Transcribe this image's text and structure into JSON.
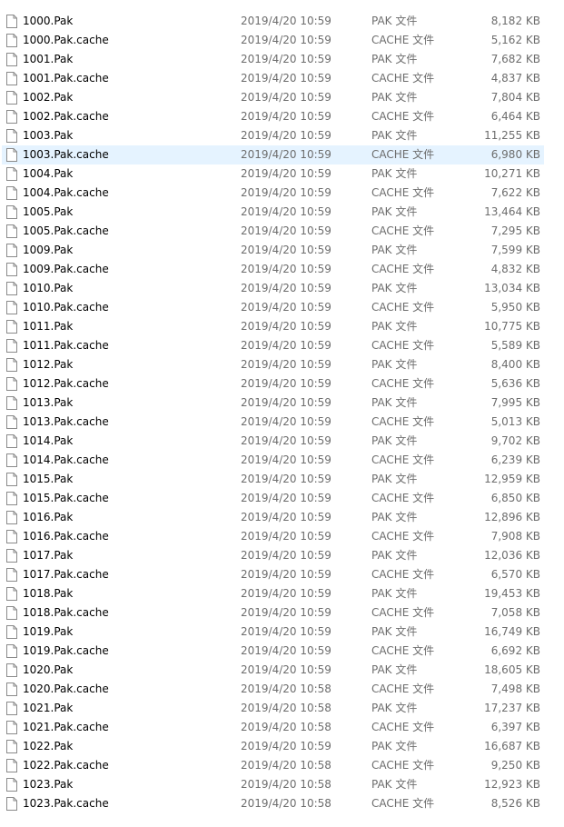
{
  "colors": {
    "name_text": "#000000",
    "detail_text": "#6d6d6d",
    "selected_row": "#e5f3ff",
    "icon_stroke": "#8a8a8a"
  },
  "icons": {
    "file": "blank-document-icon"
  },
  "files": [
    {
      "name": "1000.Pak",
      "date": "2019/4/20 10:59",
      "type": "PAK 文件",
      "size": "8,182 KB"
    },
    {
      "name": "1000.Pak.cache",
      "date": "2019/4/20 10:59",
      "type": "CACHE 文件",
      "size": "5,162 KB"
    },
    {
      "name": "1001.Pak",
      "date": "2019/4/20 10:59",
      "type": "PAK 文件",
      "size": "7,682 KB"
    },
    {
      "name": "1001.Pak.cache",
      "date": "2019/4/20 10:59",
      "type": "CACHE 文件",
      "size": "4,837 KB"
    },
    {
      "name": "1002.Pak",
      "date": "2019/4/20 10:59",
      "type": "PAK 文件",
      "size": "7,804 KB"
    },
    {
      "name": "1002.Pak.cache",
      "date": "2019/4/20 10:59",
      "type": "CACHE 文件",
      "size": "6,464 KB"
    },
    {
      "name": "1003.Pak",
      "date": "2019/4/20 10:59",
      "type": "PAK 文件",
      "size": "11,255 KB"
    },
    {
      "name": "1003.Pak.cache",
      "date": "2019/4/20 10:59",
      "type": "CACHE 文件",
      "size": "6,980 KB",
      "selected": true
    },
    {
      "name": "1004.Pak",
      "date": "2019/4/20 10:59",
      "type": "PAK 文件",
      "size": "10,271 KB"
    },
    {
      "name": "1004.Pak.cache",
      "date": "2019/4/20 10:59",
      "type": "CACHE 文件",
      "size": "7,622 KB"
    },
    {
      "name": "1005.Pak",
      "date": "2019/4/20 10:59",
      "type": "PAK 文件",
      "size": "13,464 KB"
    },
    {
      "name": "1005.Pak.cache",
      "date": "2019/4/20 10:59",
      "type": "CACHE 文件",
      "size": "7,295 KB"
    },
    {
      "name": "1009.Pak",
      "date": "2019/4/20 10:59",
      "type": "PAK 文件",
      "size": "7,599 KB"
    },
    {
      "name": "1009.Pak.cache",
      "date": "2019/4/20 10:59",
      "type": "CACHE 文件",
      "size": "4,832 KB"
    },
    {
      "name": "1010.Pak",
      "date": "2019/4/20 10:59",
      "type": "PAK 文件",
      "size": "13,034 KB"
    },
    {
      "name": "1010.Pak.cache",
      "date": "2019/4/20 10:59",
      "type": "CACHE 文件",
      "size": "5,950 KB"
    },
    {
      "name": "1011.Pak",
      "date": "2019/4/20 10:59",
      "type": "PAK 文件",
      "size": "10,775 KB"
    },
    {
      "name": "1011.Pak.cache",
      "date": "2019/4/20 10:59",
      "type": "CACHE 文件",
      "size": "5,589 KB"
    },
    {
      "name": "1012.Pak",
      "date": "2019/4/20 10:59",
      "type": "PAK 文件",
      "size": "8,400 KB"
    },
    {
      "name": "1012.Pak.cache",
      "date": "2019/4/20 10:59",
      "type": "CACHE 文件",
      "size": "5,636 KB"
    },
    {
      "name": "1013.Pak",
      "date": "2019/4/20 10:59",
      "type": "PAK 文件",
      "size": "7,995 KB"
    },
    {
      "name": "1013.Pak.cache",
      "date": "2019/4/20 10:59",
      "type": "CACHE 文件",
      "size": "5,013 KB"
    },
    {
      "name": "1014.Pak",
      "date": "2019/4/20 10:59",
      "type": "PAK 文件",
      "size": "9,702 KB"
    },
    {
      "name": "1014.Pak.cache",
      "date": "2019/4/20 10:59",
      "type": "CACHE 文件",
      "size": "6,239 KB"
    },
    {
      "name": "1015.Pak",
      "date": "2019/4/20 10:59",
      "type": "PAK 文件",
      "size": "12,959 KB"
    },
    {
      "name": "1015.Pak.cache",
      "date": "2019/4/20 10:59",
      "type": "CACHE 文件",
      "size": "6,850 KB"
    },
    {
      "name": "1016.Pak",
      "date": "2019/4/20 10:59",
      "type": "PAK 文件",
      "size": "12,896 KB"
    },
    {
      "name": "1016.Pak.cache",
      "date": "2019/4/20 10:59",
      "type": "CACHE 文件",
      "size": "7,908 KB"
    },
    {
      "name": "1017.Pak",
      "date": "2019/4/20 10:59",
      "type": "PAK 文件",
      "size": "12,036 KB"
    },
    {
      "name": "1017.Pak.cache",
      "date": "2019/4/20 10:59",
      "type": "CACHE 文件",
      "size": "6,570 KB"
    },
    {
      "name": "1018.Pak",
      "date": "2019/4/20 10:59",
      "type": "PAK 文件",
      "size": "19,453 KB"
    },
    {
      "name": "1018.Pak.cache",
      "date": "2019/4/20 10:59",
      "type": "CACHE 文件",
      "size": "7,058 KB"
    },
    {
      "name": "1019.Pak",
      "date": "2019/4/20 10:59",
      "type": "PAK 文件",
      "size": "16,749 KB"
    },
    {
      "name": "1019.Pak.cache",
      "date": "2019/4/20 10:59",
      "type": "CACHE 文件",
      "size": "6,692 KB"
    },
    {
      "name": "1020.Pak",
      "date": "2019/4/20 10:59",
      "type": "PAK 文件",
      "size": "18,605 KB"
    },
    {
      "name": "1020.Pak.cache",
      "date": "2019/4/20 10:58",
      "type": "CACHE 文件",
      "size": "7,498 KB"
    },
    {
      "name": "1021.Pak",
      "date": "2019/4/20 10:58",
      "type": "PAK 文件",
      "size": "17,237 KB"
    },
    {
      "name": "1021.Pak.cache",
      "date": "2019/4/20 10:58",
      "type": "CACHE 文件",
      "size": "6,397 KB"
    },
    {
      "name": "1022.Pak",
      "date": "2019/4/20 10:59",
      "type": "PAK 文件",
      "size": "16,687 KB"
    },
    {
      "name": "1022.Pak.cache",
      "date": "2019/4/20 10:58",
      "type": "CACHE 文件",
      "size": "9,250 KB"
    },
    {
      "name": "1023.Pak",
      "date": "2019/4/20 10:58",
      "type": "PAK 文件",
      "size": "12,923 KB"
    },
    {
      "name": "1023.Pak.cache",
      "date": "2019/4/20 10:58",
      "type": "CACHE 文件",
      "size": "8,526 KB"
    }
  ]
}
